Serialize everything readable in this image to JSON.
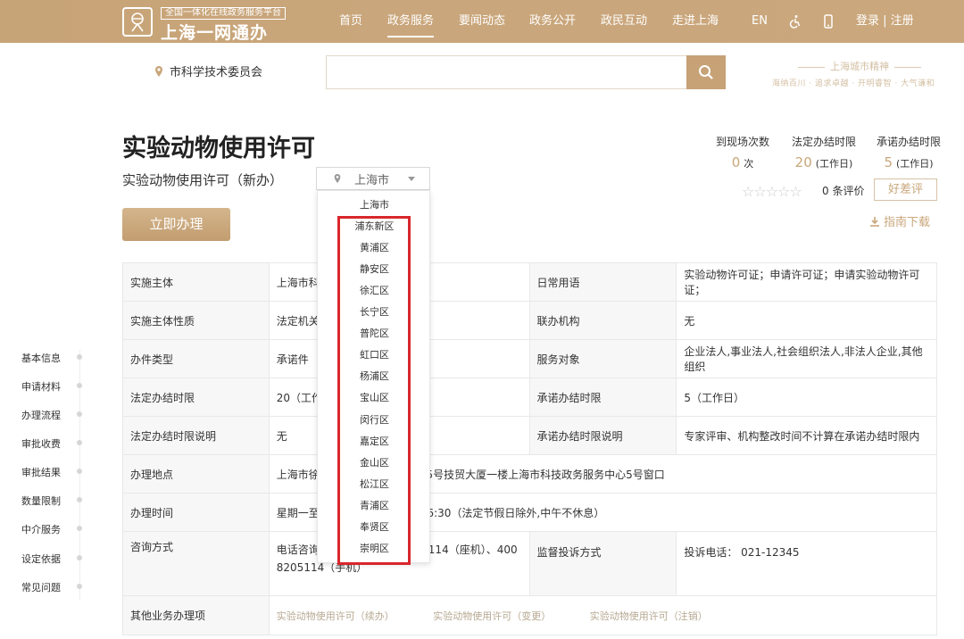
{
  "header": {
    "logo_subtitle": "全国一体化在线政务服务平台",
    "logo_title": "上海一网通办",
    "nav": [
      {
        "label": "首页",
        "active": false
      },
      {
        "label": "政务服务",
        "active": true
      },
      {
        "label": "要闻动态",
        "active": false
      },
      {
        "label": "政务公开",
        "active": false
      },
      {
        "label": "政民互动",
        "active": false
      },
      {
        "label": "走进上海",
        "active": false
      },
      {
        "label": "EN",
        "active": false
      }
    ],
    "login": "登录 | 注册"
  },
  "search": {
    "department": "市科学技术委员会",
    "placeholder": "",
    "slogan_title": "上海城市精神",
    "slogan_sub": "海纳百川 · 追求卓越 · 开明睿智 · 大气谦和"
  },
  "item": {
    "title": "实验动物使用许可",
    "subtitle": "实验动物使用许可（新办）",
    "region_selected": "上海市",
    "apply_button": "立即办理"
  },
  "stats": [
    {
      "label": "到现场次数",
      "value": "0",
      "unit": "次"
    },
    {
      "label": "法定办结时限",
      "value": "20",
      "unit": "(工作日)"
    },
    {
      "label": "承诺办结时限",
      "value": "5",
      "unit": "(工作日)"
    }
  ],
  "rating": {
    "stars": "☆☆☆☆☆",
    "count_text": "0 条评价",
    "button": "好差评"
  },
  "guide_download": "指南下载",
  "table": {
    "row1": {
      "k1": "实施主体",
      "v1": "上海市科",
      "k2": "日常用语",
      "v2": "实验动物许可证；申请许可证；申请实验动物许可证；"
    },
    "row2": {
      "k1": "实施主体性质",
      "v1": "法定机关",
      "k2": "联办机构",
      "v2": "无"
    },
    "row3": {
      "k1": "办件类型",
      "v1": "承诺件",
      "k2": "服务对象",
      "v2": "企业法人,事业法人,社会组织法人,非法人企业,其他组织"
    },
    "row4": {
      "k1": "法定办结时限",
      "v1": "20（工作",
      "k2": "承诺办结时限",
      "v2": "5（工作日）"
    },
    "row5": {
      "k1": "法定办结时限说明",
      "v1": "无",
      "k2": "承诺办结时限说明",
      "v2": "专家评审、机构整改时间不计算在承诺办结时限内"
    },
    "row6": {
      "k1": "办理地点",
      "v1_left": "上海市徐",
      "v1_right": "25号技贸大厦一楼上海市科技政务服务中心5号窗口"
    },
    "row7": {
      "k1": "办理时间",
      "v1_left": "星期一至",
      "v1_right": "16:30（法定节假日除外,中午不休息）"
    },
    "row8": {
      "k1": "咨询方式",
      "v1_line1_left": "电话咨询",
      "v1_line1_right": "114（座机）、400",
      "v1_line2": "8205114（手机）",
      "k2": "监督投诉方式",
      "v2": "投诉电话： 021-12345"
    },
    "row9": {
      "k1": "其他业务办理项",
      "links": [
        "实验动物使用许可（续办）",
        "实验动物使用许可（变更）",
        "实验动物使用许可（注销）"
      ]
    }
  },
  "sidebar": [
    "基本信息",
    "申请材料",
    "办理流程",
    "审批收费",
    "审批结果",
    "数量限制",
    "中介服务",
    "设定依据",
    "常见问题"
  ],
  "dropdown": [
    "上海市",
    "浦东新区",
    "黄浦区",
    "静安区",
    "徐汇区",
    "长宁区",
    "普陀区",
    "虹口区",
    "杨浦区",
    "宝山区",
    "闵行区",
    "嘉定区",
    "金山区",
    "松江区",
    "青浦区",
    "奉贤区",
    "崇明区"
  ],
  "colors": {
    "brand": "#c8a579",
    "highlight": "#d9262b"
  }
}
